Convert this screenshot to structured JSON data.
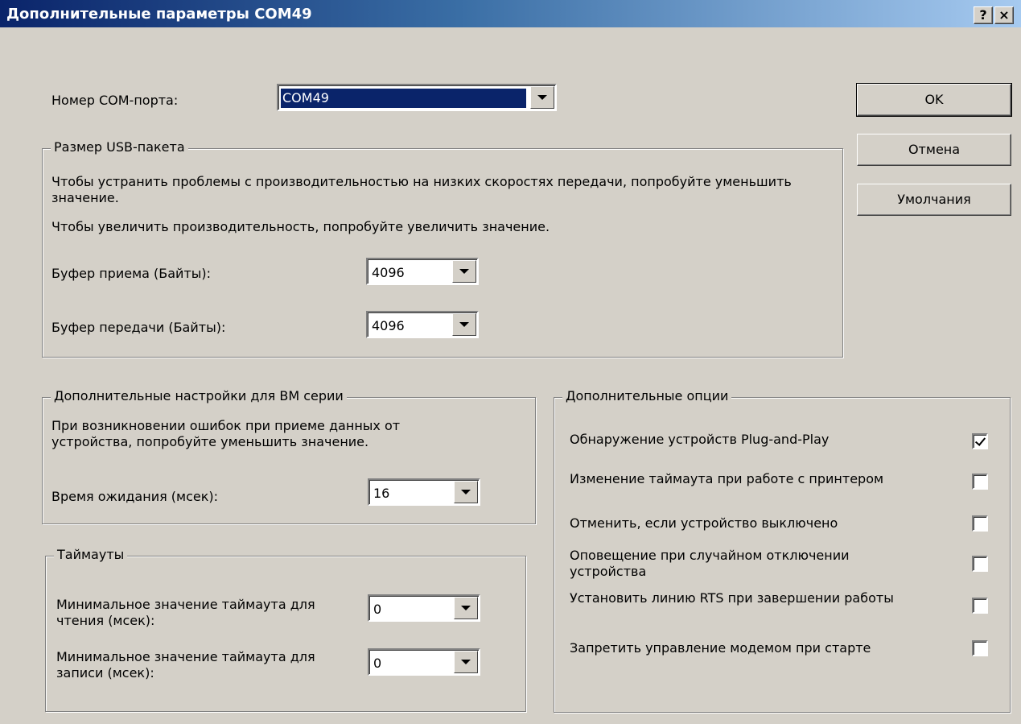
{
  "window": {
    "title": "Дополнительные параметры COM49",
    "help_button": "?",
    "close_button": "×"
  },
  "com_port": {
    "label": "Номер COM-порта:",
    "value": "COM49"
  },
  "buttons": {
    "ok": "OK",
    "cancel": "Отмена",
    "defaults": "Умолчания"
  },
  "usb_packet": {
    "legend": "Размер USB-пакета",
    "desc_line1": "Чтобы устранить проблемы с производительностью на низких скоростях передачи, попробуйте уменьшить значение.",
    "desc_line2": "Чтобы увеличить производительность, попробуйте увеличить значение.",
    "rx_label": "Буфер приема (Байты):",
    "rx_value": "4096",
    "tx_label": "Буфер передачи (Байты):",
    "tx_value": "4096"
  },
  "bm_settings": {
    "legend": "Дополнительные настройки для BM серии",
    "desc": "При возникновении ошибок при приеме данных от устройства, попробуйте уменьшить значение.",
    "latency_label": "Время ожидания (мсек):",
    "latency_value": "16"
  },
  "timeouts": {
    "legend": "Таймауты",
    "read_label": "Минимальное значение таймаута для чтения (мсек):",
    "read_value": "0",
    "write_label": "Минимальное значение таймаута для записи (мсек):",
    "write_value": "0"
  },
  "options": {
    "legend": "Дополнительные опции",
    "items": [
      {
        "label": "Обнаружение устройств Plug-and-Play",
        "checked": true
      },
      {
        "label": "Изменение таймаута при работе с принтером",
        "checked": false
      },
      {
        "label": "Отменить, если устройство выключено",
        "checked": false
      },
      {
        "label": "Оповещение при случайном отключении устройства",
        "checked": false
      },
      {
        "label": "Установить линию RTS при завершении работы",
        "checked": false
      },
      {
        "label": "Запретить управление модемом при старте",
        "checked": false
      }
    ]
  }
}
